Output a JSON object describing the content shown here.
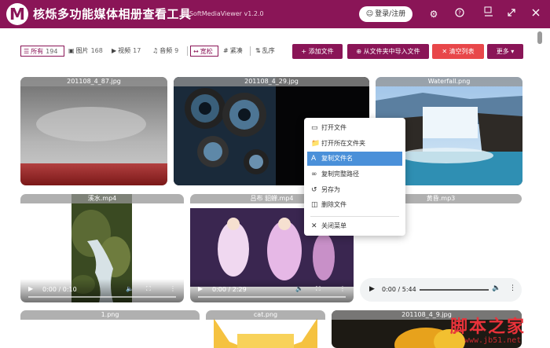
{
  "app": {
    "logo_letter": "M",
    "title": "核烁多功能媒体相册查看工具",
    "subtitle": "HeSoftMediaViewer v1.2.0",
    "login_label": "登录/注册",
    "accent": "#8a1557"
  },
  "filters": {
    "all": {
      "label": "所有",
      "count": "194"
    },
    "image": {
      "label": "图片",
      "count": "168"
    },
    "video": {
      "label": "视频",
      "count": "17"
    },
    "audio": {
      "label": "音频",
      "count": "9"
    },
    "loose": "宽松",
    "compact": "紧凑",
    "shuffle": "乱序"
  },
  "actions": {
    "add_file": "添加文件",
    "import_folder": "从文件夹中导入文件",
    "clear_list": "清空列表",
    "more": "更多"
  },
  "cards": {
    "c1": {
      "title": "201108_4_87.jpg"
    },
    "c2": {
      "title": "201108_4_29.jpg"
    },
    "c3": {
      "title": "Waterfall.png"
    },
    "c4": {
      "title": "溪水.mp4",
      "time": "0:00 / 0:10"
    },
    "c5": {
      "title": "吕布 貂蝉.mp4",
      "time": "0:00 / 2:29"
    },
    "c6": {
      "title": "黄昏.mp3",
      "time": "0:00 / 5:44"
    },
    "c7": {
      "title": "1.png"
    },
    "c8": {
      "title": "cat.png"
    },
    "c9": {
      "title": "201108_4_9.jpg"
    }
  },
  "context_menu": {
    "open_file": "打开文件",
    "open_folder": "打开所在文件夹",
    "copy_name": "复制文件名",
    "copy_path": "复制完整路径",
    "save_as": "另存为",
    "delete": "删除文件",
    "close": "关闭菜单"
  },
  "watermark": {
    "text": "脚本之家",
    "url": "www.jb51.net"
  }
}
